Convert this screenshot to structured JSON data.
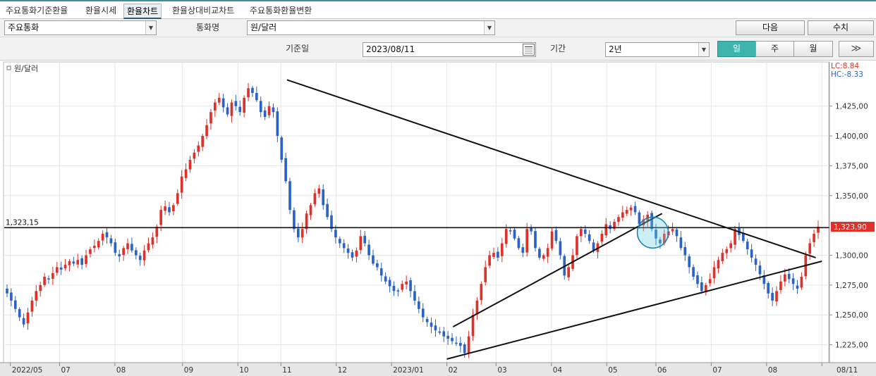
{
  "tabs": [
    "주요통화기준환율",
    "환율시세",
    "환율차트",
    "환율상대비교차트",
    "주요통화환율변환"
  ],
  "active_tab": 2,
  "controls": {
    "currency_group": "주요통화",
    "currency_label": "통화명",
    "currency_value": "원/달러",
    "next_button": "다음",
    "value_button": "수치",
    "base_date_label": "기준일",
    "base_date_value": "2023/08/11",
    "period_label": "기간",
    "period_value": "2년",
    "interval_day": "일",
    "interval_week": "주",
    "interval_month": "월",
    "forward_icon": "double-chevron-right-icon"
  },
  "colors": {
    "up": "#e0302a",
    "down": "#2a62c8",
    "accent": "#3fb3ae",
    "price_box": "#e0302a"
  },
  "chart_data": {
    "type": "candlestick",
    "title": "원/달러",
    "lc_label": "LC:8.84",
    "hc_label": "HC:-8.33",
    "ylim": [
      1210,
      1462
    ],
    "yticks": [
      {
        "value": 1425,
        "label": "1,425,00"
      },
      {
        "value": 1400,
        "label": "1,400,00"
      },
      {
        "value": 1375,
        "label": "1,375,00"
      },
      {
        "value": 1350,
        "label": "1,350,00"
      },
      {
        "value": 1300,
        "label": "1,300,00"
      },
      {
        "value": 1275,
        "label": "1,275,00"
      },
      {
        "value": 1250,
        "label": "1,250,00"
      },
      {
        "value": 1225,
        "label": "1,225,00"
      }
    ],
    "xticks": [
      {
        "day": 0,
        "label": "2022/05"
      },
      {
        "day": 8,
        "label": "07"
      },
      {
        "day": 17,
        "label": "08"
      },
      {
        "day": 28,
        "label": "09"
      },
      {
        "day": 37,
        "label": "10"
      },
      {
        "day": 44,
        "label": "11"
      },
      {
        "day": 53,
        "label": "12"
      },
      {
        "day": 62,
        "label": "2023/01"
      },
      {
        "day": 71,
        "label": "02"
      },
      {
        "day": 79,
        "label": "03"
      },
      {
        "day": 88,
        "label": "04"
      },
      {
        "day": 97,
        "label": "05"
      },
      {
        "day": 105,
        "label": "06"
      },
      {
        "day": 114,
        "label": "07"
      },
      {
        "day": 123,
        "label": "08"
      },
      {
        "day": 132,
        "label": "08/11"
      }
    ],
    "day_span": [
      -1,
      133
    ],
    "close_series": [
      1268,
      1262,
      1255,
      1248,
      1242,
      1252,
      1262,
      1270,
      1275,
      1282,
      1280,
      1285,
      1290,
      1288,
      1292,
      1295,
      1293,
      1296,
      1292,
      1300,
      1305,
      1308,
      1312,
      1318,
      1315,
      1310,
      1302,
      1299,
      1306,
      1310,
      1304,
      1300,
      1296,
      1304,
      1310,
      1315,
      1324,
      1338,
      1341,
      1336,
      1342,
      1352,
      1366,
      1372,
      1380,
      1386,
      1392,
      1400,
      1409,
      1420,
      1428,
      1432,
      1424,
      1418,
      1428,
      1425,
      1420,
      1432,
      1440,
      1436,
      1430,
      1420,
      1416,
      1425,
      1420,
      1400,
      1380,
      1362,
      1338,
      1322,
      1315,
      1322,
      1335,
      1342,
      1352,
      1356,
      1342,
      1332,
      1322,
      1315,
      1310,
      1306,
      1302,
      1298,
      1304,
      1316,
      1310,
      1300,
      1293,
      1290,
      1283,
      1278,
      1274,
      1270,
      1270,
      1276,
      1278,
      1270,
      1262,
      1255,
      1248,
      1244,
      1240,
      1237,
      1235,
      1232,
      1230,
      1228,
      1226,
      1224,
      1218,
      1232,
      1250,
      1262,
      1276,
      1290,
      1300,
      1302,
      1298,
      1310,
      1322,
      1320,
      1314,
      1306,
      1302,
      1322,
      1320,
      1306,
      1298,
      1300,
      1306,
      1320,
      1312,
      1300,
      1283,
      1290,
      1300,
      1316,
      1322,
      1318,
      1312,
      1304,
      1310,
      1318,
      1326,
      1322,
      1328,
      1332,
      1336,
      1338,
      1340,
      1336,
      1326,
      1330,
      1334,
      1322,
      1314,
      1310,
      1318,
      1320,
      1322,
      1316,
      1306,
      1300,
      1290,
      1282,
      1276,
      1270,
      1275,
      1280,
      1290,
      1296,
      1302,
      1305,
      1310,
      1322,
      1317,
      1312,
      1305,
      1298,
      1292,
      1284,
      1276,
      1268,
      1262,
      1270,
      1278,
      1284,
      1280,
      1276,
      1272,
      1282,
      1300,
      1310,
      1318,
      1323.9
    ],
    "reference_line": {
      "value": 1323.15,
      "label": "1,323,15"
    },
    "current_price": {
      "value": 1323.9,
      "label": "1,323,90"
    },
    "trendlines": [
      {
        "from": {
          "day": 45,
          "value": 1447
        },
        "to": {
          "day": 131,
          "value": 1298
        }
      },
      {
        "from": {
          "day": 71,
          "value": 1213
        },
        "to": {
          "day": 132,
          "value": 1295
        }
      },
      {
        "from": {
          "day": 72,
          "value": 1240
        },
        "to": {
          "day": 106,
          "value": 1335
        }
      }
    ],
    "highlight_circle": {
      "day": 104.5,
      "value": 1319,
      "radius_value": 13
    },
    "grid": true,
    "legend": "top-left"
  }
}
